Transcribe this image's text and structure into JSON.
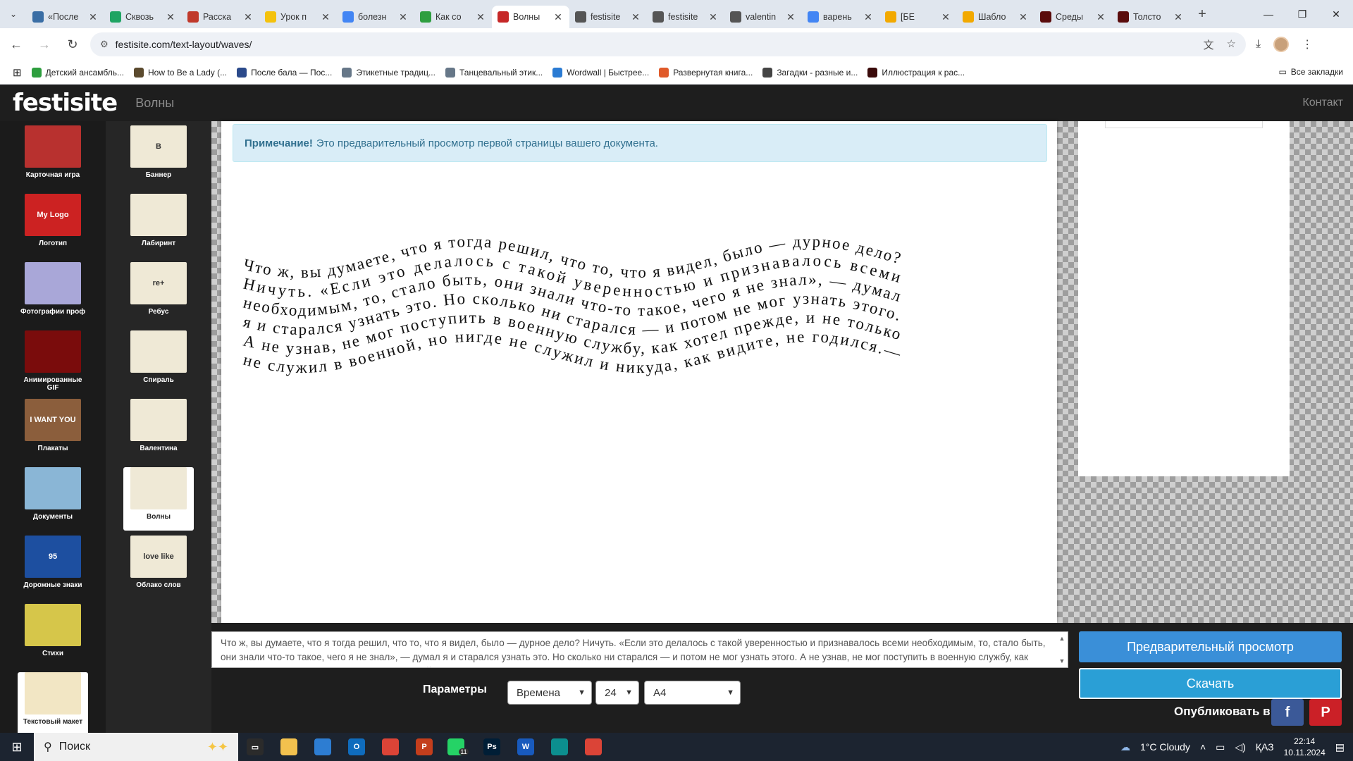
{
  "browser": {
    "tabs": [
      {
        "title": "«После",
        "icon": "tilde-icon",
        "color": "#3a6ea5"
      },
      {
        "title": "Сквозь",
        "icon": "check-icon",
        "color": "#1fa463"
      },
      {
        "title": "Расска",
        "icon": "target-icon",
        "color": "#c0392b"
      },
      {
        "title": "Урок п",
        "icon": "bookmark-icon",
        "color": "#f4c20d"
      },
      {
        "title": "болезн",
        "icon": "google-icon",
        "color": "#4285f4"
      },
      {
        "title": "Как со",
        "icon": "doc-icon",
        "color": "#2e9e3f"
      },
      {
        "title": "Волны",
        "icon": "festisite-icon",
        "color": "#c62828",
        "active": true
      },
      {
        "title": "festisite",
        "icon": "globe-icon",
        "color": "#555555"
      },
      {
        "title": "festisite",
        "icon": "globe-icon",
        "color": "#555555"
      },
      {
        "title": "valentin",
        "icon": "globe-icon",
        "color": "#555555"
      },
      {
        "title": "варень",
        "icon": "google-icon",
        "color": "#4285f4"
      },
      {
        "title": "[БЕ",
        "icon": "badge-icon",
        "color": "#f2a900"
      },
      {
        "title": "Шабло",
        "icon": "badge-icon",
        "color": "#f2a900"
      },
      {
        "title": "Среды",
        "icon": "square-icon",
        "color": "#5a0c0c"
      },
      {
        "title": "Толсто",
        "icon": "square-icon",
        "color": "#5a0c0c"
      }
    ],
    "url": "festisite.com/text-layout/waves/",
    "bookmarks": [
      {
        "label": "Детский ансамбль...",
        "color": "#2e9e3f"
      },
      {
        "label": "How to Be a Lady (...",
        "color": "#5b4a2e"
      },
      {
        "label": "После бала — Пос...",
        "color": "#2b4a8b"
      },
      {
        "label": "Этикетные традиц...",
        "color": "#667788"
      },
      {
        "label": "Танцевальный этик...",
        "color": "#667788"
      },
      {
        "label": "Wordwall | Быстрее...",
        "color": "#2a7bd3"
      },
      {
        "label": "Развернутая книга...",
        "color": "#e05a2a"
      },
      {
        "label": "Загадки - разные и...",
        "color": "#444444"
      },
      {
        "label": "Иллюстрация к рас...",
        "color": "#3a0a0a"
      }
    ],
    "all_bookmarks": "Все закладки"
  },
  "site": {
    "logo": "festisite",
    "page_name": "Волны",
    "contact": "Контакт"
  },
  "categories": [
    {
      "label": "Карточная игра",
      "icon": "playing-card-icon",
      "color": "#b8312f"
    },
    {
      "label": "Логотип",
      "icon": "logo-icon",
      "color": "#cc2222",
      "thumb_text": "My Logo"
    },
    {
      "label": "Фотографии проф",
      "icon": "profile-photo-icon",
      "color": "#a9a7d8"
    },
    {
      "label": "Анимированные GIF",
      "icon": "play-icon",
      "color": "#7a0c0c"
    },
    {
      "label": "Плакаты",
      "icon": "poster-icon",
      "color": "#8b5e3c",
      "thumb_text": "I WANT YOU"
    },
    {
      "label": "Документы",
      "icon": "id-card-icon",
      "color": "#8ab6d6"
    },
    {
      "label": "Дорожные знаки",
      "icon": "road-sign-icon",
      "color": "#1d4fa0",
      "thumb_text": "95"
    },
    {
      "label": "Стихи",
      "icon": "scroll-icon",
      "color": "#d6c64a"
    },
    {
      "label": "Текстовый макет",
      "icon": "text-layout-icon",
      "color": "#f2e6c4",
      "selected": true
    }
  ],
  "templates": [
    {
      "label": "Баннер",
      "icon": "banner-icon",
      "thumb_text": "B"
    },
    {
      "label": "Лабиринт",
      "icon": "maze-icon"
    },
    {
      "label": "Ребус",
      "icon": "rebus-icon",
      "thumb_text": "re+"
    },
    {
      "label": "Спираль",
      "icon": "spiral-icon"
    },
    {
      "label": "Валентина",
      "icon": "heart-icon"
    },
    {
      "label": "Волны",
      "icon": "waves-icon",
      "selected": true
    },
    {
      "label": "Облако слов",
      "icon": "word-cloud-icon",
      "thumb_text": "love like"
    }
  ],
  "note": {
    "bold": "Примечание!",
    "text": "Это предварительный просмотр первой страницы вашего документа."
  },
  "wave_lines": [
    "Что ж, вы думаете, что я тогда решил, что то, что я видел, было — дурное дело?",
    "Ничуть. «Если это делалось с такой уверенностью и признавалось всеми",
    "необходимым, то, стало быть, они знали что-то такое, чего я не знал», — думал",
    "я и старался узнать это. Но сколько ни старался — и потом не мог узнать этого.",
    "А не узнав, не мог поступить в военную службу, как хотел прежде, и не только",
    "не служил в военной, но нигде не служил и никуда, как видите, не годился.—"
  ],
  "input_text": "Что ж, вы думаете, что я тогда решил, что то, что я видел, было — дурное дело? Ничуть. «Если это делалось с такой уверенностью и признавалось всеми необходимым, то, стало быть, они знали что-то такое, чего я не знал», — думал я и старался узнать это. Но сколько ни старался — и потом не мог узнать этого. А не узнав, не мог поступить в военную службу, как хотел прежде, и не только не служил в военной, но нигде не служил и никуда, как видите, не годился.",
  "params": {
    "label": "Параметры",
    "font": "Времена",
    "size": "24",
    "paper": "A4"
  },
  "actions": {
    "preview": "Предварительный просмотр",
    "download": "Скачать",
    "publish": "Опубликовать в:",
    "facebook": "f",
    "pinterest": "P"
  },
  "taskbar": {
    "search": "Поиск",
    "apps": [
      {
        "name": "task-view",
        "color": "#2b2b2b",
        "glyph": "▭"
      },
      {
        "name": "file-explorer",
        "color": "#f2c14e",
        "glyph": ""
      },
      {
        "name": "store",
        "color": "#2d7dd2",
        "glyph": ""
      },
      {
        "name": "outlook",
        "color": "#0f6cbd",
        "glyph": "O"
      },
      {
        "name": "chrome",
        "color": "#db4437",
        "glyph": ""
      },
      {
        "name": "powerpoint",
        "color": "#c43e1c",
        "glyph": "P"
      },
      {
        "name": "whatsapp",
        "color": "#25d366",
        "glyph": ""
      },
      {
        "name": "photoshop",
        "color": "#001e36",
        "glyph": "Ps"
      },
      {
        "name": "word",
        "color": "#185abd",
        "glyph": "W"
      },
      {
        "name": "edge",
        "color": "#0c8f8f",
        "glyph": ""
      },
      {
        "name": "chrome-active",
        "color": "#db4437",
        "glyph": ""
      }
    ],
    "weather": "1°C  Cloudy",
    "lang": "ҚАЗ",
    "time": "22:14",
    "date": "10.11.2024",
    "whatsapp_badge": "11"
  }
}
